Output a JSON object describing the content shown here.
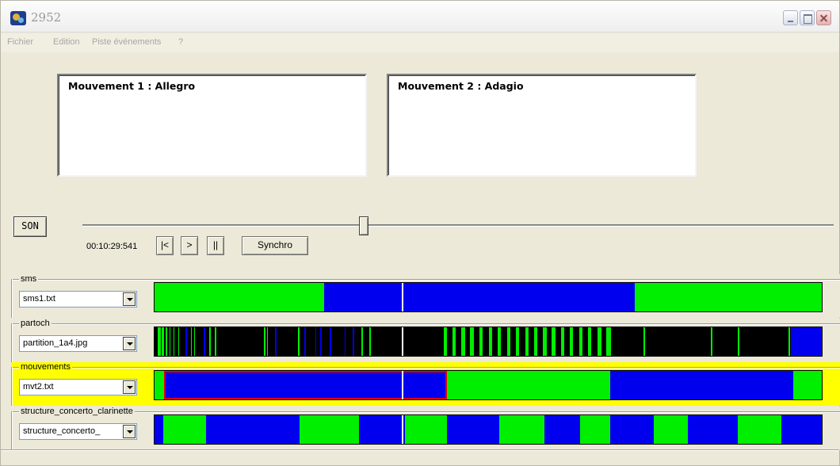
{
  "window": {
    "title": "2952"
  },
  "menu": {
    "items": [
      "Fichier",
      "Edition",
      "Piste événements",
      "?"
    ]
  },
  "panels": [
    {
      "title": "Mouvement 1 : Allegro"
    },
    {
      "title": "Mouvement 2 : Adagio"
    }
  ],
  "player": {
    "son_label": "SON",
    "time": "00:10:29:541",
    "btn_prev": "|<",
    "btn_play": ">",
    "btn_pause": "||",
    "btn_sync": "Synchro",
    "position_fraction": 0.37
  },
  "colors": {
    "green": "#00ee00",
    "blue": "#0000ee",
    "black": "#000000",
    "highlight": "#ffff00",
    "selection": "#dd0000"
  },
  "tracks": [
    {
      "label": "sms",
      "file": "sms1.txt",
      "highlight": false,
      "segments": [
        [
          "green",
          0,
          0.254
        ],
        [
          "blue",
          0.254,
          0.718
        ],
        [
          "green",
          0.718,
          1.0
        ]
      ]
    },
    {
      "label": "partoch",
      "file": "partition_1a4.jpg",
      "highlight": false,
      "segments": [
        [
          "black",
          0,
          1.0
        ],
        [
          "green",
          0.005,
          0.009
        ],
        [
          "green",
          0.011,
          0.014
        ],
        [
          "green",
          0.016,
          0.019
        ],
        [
          "green",
          0.022,
          0.024
        ],
        [
          "green",
          0.028,
          0.03
        ],
        [
          "green",
          0.035,
          0.037
        ],
        [
          "blue",
          0.046,
          0.048
        ],
        [
          "green",
          0.054,
          0.056
        ],
        [
          "green",
          0.059,
          0.061
        ],
        [
          "blue",
          0.074,
          0.076
        ],
        [
          "green",
          0.082,
          0.084
        ],
        [
          "green",
          0.09,
          0.093
        ],
        [
          "green",
          0.163,
          0.166
        ],
        [
          "green",
          0.168,
          0.17
        ],
        [
          "blue",
          0.18,
          0.182
        ],
        [
          "green",
          0.215,
          0.217
        ],
        [
          "blue",
          0.224,
          0.226
        ],
        [
          "blue",
          0.24,
          0.242
        ],
        [
          "blue",
          0.248,
          0.25
        ],
        [
          "blue",
          0.262,
          0.264
        ],
        [
          "blue",
          0.284,
          0.286
        ],
        [
          "blue",
          0.296,
          0.298
        ],
        [
          "green",
          0.309,
          0.312
        ],
        [
          "green",
          0.321,
          0.324
        ],
        [
          "green",
          0.432,
          0.437
        ],
        [
          "green",
          0.445,
          0.45
        ],
        [
          "green",
          0.459,
          0.464
        ],
        [
          "green",
          0.472,
          0.477
        ],
        [
          "green",
          0.486,
          0.491
        ],
        [
          "green",
          0.5,
          0.505
        ],
        [
          "green",
          0.513,
          0.518
        ],
        [
          "green",
          0.527,
          0.532
        ],
        [
          "green",
          0.54,
          0.545
        ],
        [
          "green",
          0.554,
          0.559
        ],
        [
          "green",
          0.567,
          0.572
        ],
        [
          "green",
          0.581,
          0.586
        ],
        [
          "green",
          0.594,
          0.599
        ],
        [
          "green",
          0.608,
          0.613
        ],
        [
          "green",
          0.621,
          0.626
        ],
        [
          "green",
          0.635,
          0.64
        ],
        [
          "green",
          0.648,
          0.653
        ],
        [
          "green",
          0.662,
          0.668
        ],
        [
          "green",
          0.675,
          0.682
        ],
        [
          "green",
          0.731,
          0.733
        ],
        [
          "green",
          0.832,
          0.834
        ],
        [
          "green",
          0.872,
          0.874
        ],
        [
          "green",
          0.948,
          0.95
        ],
        [
          "blue",
          0.952,
          1.0
        ]
      ]
    },
    {
      "label": "mouvements",
      "file": "mvt2.txt",
      "highlight": true,
      "segments": [
        [
          "green",
          0,
          0.014
        ],
        [
          "blue",
          0.014,
          0.437
        ],
        [
          "green",
          0.437,
          0.681
        ],
        [
          "blue",
          0.681,
          0.955
        ],
        [
          "green",
          0.955,
          1.0
        ]
      ],
      "selection": [
        0.014,
        0.437
      ]
    },
    {
      "label": "structure_concerto_clarinette",
      "file": "structure_concerto_",
      "highlight": false,
      "segments": [
        [
          "blue",
          0,
          0.013
        ],
        [
          "green",
          0.013,
          0.077
        ],
        [
          "blue",
          0.077,
          0.217
        ],
        [
          "green",
          0.217,
          0.306
        ],
        [
          "blue",
          0.306,
          0.374
        ],
        [
          "green",
          0.374,
          0.437
        ],
        [
          "blue",
          0.437,
          0.515
        ],
        [
          "green",
          0.515,
          0.583
        ],
        [
          "blue",
          0.583,
          0.636
        ],
        [
          "green",
          0.636,
          0.681
        ],
        [
          "blue",
          0.681,
          0.747
        ],
        [
          "green",
          0.747,
          0.797
        ],
        [
          "blue",
          0.797,
          0.872
        ],
        [
          "green",
          0.872,
          0.937
        ],
        [
          "blue",
          0.937,
          1.0
        ]
      ]
    }
  ]
}
